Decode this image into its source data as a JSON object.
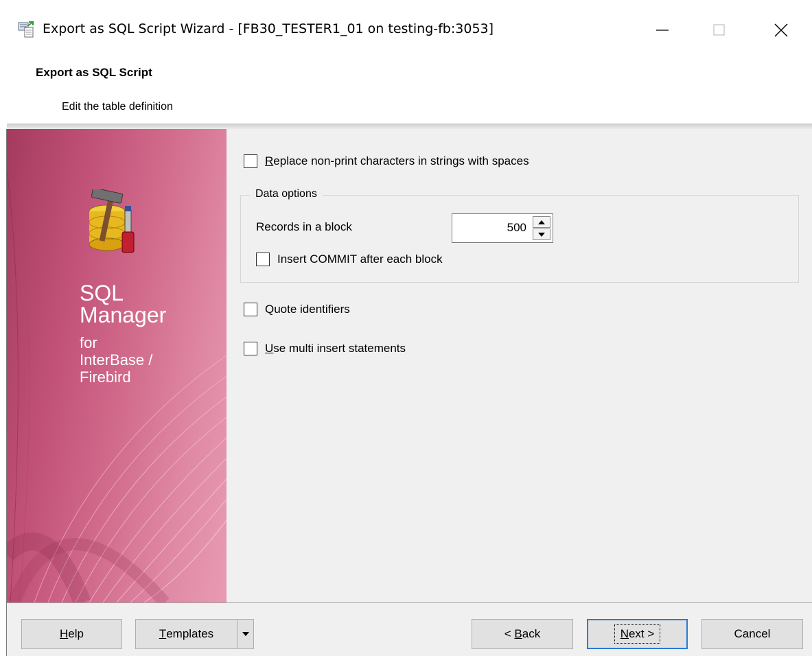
{
  "window": {
    "title": "Export as SQL Script Wizard - [FB30_TESTER1_01 on testing-fb:3053]"
  },
  "header": {
    "title": "Export as SQL Script",
    "subtitle": "Edit the table definition"
  },
  "banner": {
    "line1": "SQL",
    "line2": "Manager",
    "line3": "for",
    "line4": "InterBase /",
    "line5": "Firebird"
  },
  "options": {
    "replace_nonprint": {
      "label_accel": "R",
      "label_rest": "eplace non-print characters in strings with spaces",
      "checked": false
    },
    "data_options": {
      "legend": "Data options",
      "records_label": "Records in a block",
      "records_value": "500",
      "insert_commit": {
        "label": "Insert COMMIT after each block",
        "checked": false
      }
    },
    "quote_identifiers": {
      "label": "Quote identifiers",
      "checked": false
    },
    "multi_insert": {
      "label_accel": "U",
      "label_rest": "se multi insert statements",
      "checked": false
    }
  },
  "footer": {
    "help": {
      "accel": "H",
      "rest": "elp"
    },
    "templates": {
      "accel": "T",
      "rest": "emplates"
    },
    "back": {
      "prefix": "< ",
      "accel": "B",
      "rest": "ack"
    },
    "next": {
      "accel": "N",
      "rest": "ext >"
    },
    "cancel": "Cancel"
  },
  "colors": {
    "banner_dark": "#a43a5f",
    "banner_light": "#e89bb2",
    "focus_border": "#2b7ad6",
    "panel_bg": "#f0f0f0"
  },
  "icons": [
    "app-export-icon",
    "minimize-icon",
    "maximize-icon",
    "close-icon",
    "sql-manager-logo-icon",
    "spin-up-icon",
    "spin-down-icon",
    "dropdown-arrow-icon"
  ]
}
